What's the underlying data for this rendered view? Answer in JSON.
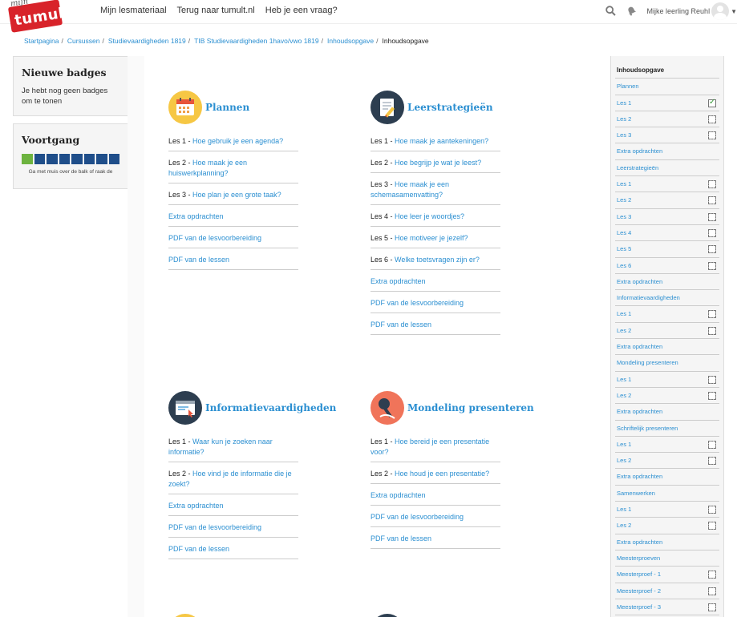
{
  "header": {
    "logo_small": "mijn",
    "logo_text": "tumult",
    "nav": [
      "Mijn lesmateriaal",
      "Terug naar tumult.nl",
      "Heb je een vraag?"
    ],
    "user_name": "Mijke leerling Reuhl"
  },
  "breadcrumb": [
    "Startpagina",
    "Cursussen",
    "Studievaardigheden 1819",
    "TIB Studievaardigheden 1havo/vwo 1819",
    "Inhoudsopgave",
    "Inhoudsopgave"
  ],
  "badges": {
    "title": "Nieuwe badges",
    "text": "Je hebt nog geen badges om te tonen"
  },
  "progress": {
    "title": "Voortgang",
    "note": "Ga met muis over de balk of raak de",
    "segments_total": 8,
    "segments_done": 1
  },
  "sections": [
    {
      "title": "Plannen",
      "icon": "calendar-icon",
      "color": "#f6c744",
      "items": [
        {
          "prefix": "Les 1 - ",
          "text": "Hoe gebruik je een agenda?"
        },
        {
          "prefix": "Les 2 - ",
          "text": "Hoe maak je een huiswerkplanning?"
        },
        {
          "prefix": "Les 3 - ",
          "text": "Hoe plan je een grote taak?"
        },
        {
          "prefix": "",
          "text": "Extra opdrachten"
        },
        {
          "prefix": "",
          "text": "PDF van de lesvoorbereiding"
        },
        {
          "prefix": "",
          "text": "PDF van de lessen"
        }
      ]
    },
    {
      "title": "Leerstrategieën",
      "icon": "notepad-pencil-icon",
      "color": "#2d3e50",
      "items": [
        {
          "prefix": "Les 1 - ",
          "text": "Hoe maak je aantekeningen?"
        },
        {
          "prefix": "Les 2 - ",
          "text": "Hoe begrijp je wat je leest?"
        },
        {
          "prefix": "Les 3 - ",
          "text": "Hoe maak je een schemasamenvatting?"
        },
        {
          "prefix": "Les 4 - ",
          "text": "Hoe leer je woordjes?"
        },
        {
          "prefix": "Les 5 - ",
          "text": "Hoe motiveer je jezelf?"
        },
        {
          "prefix": "Les 6 - ",
          "text": "Welke toetsvragen zijn er?"
        },
        {
          "prefix": "",
          "text": "Extra opdrachten"
        },
        {
          "prefix": "",
          "text": "PDF van de lesvoorbereiding"
        },
        {
          "prefix": "",
          "text": "PDF van de lessen"
        }
      ]
    },
    {
      "title": "Informatievaardigheden",
      "icon": "browser-window-icon",
      "color": "#2d3e50",
      "items": [
        {
          "prefix": "Les 1 - ",
          "text": "Waar kun je zoeken naar informatie?"
        },
        {
          "prefix": "Les 2 - ",
          "text": "Hoe vind je de informatie die je zoekt?"
        },
        {
          "prefix": "",
          "text": "Extra opdrachten"
        },
        {
          "prefix": "",
          "text": "PDF van de lesvoorbereiding"
        },
        {
          "prefix": "",
          "text": "PDF van de lessen"
        }
      ]
    },
    {
      "title": "Mondeling presenteren",
      "icon": "microphone-icon",
      "color": "#f0745a",
      "items": [
        {
          "prefix": "Les 1 - ",
          "text": "Hoe bereid je een presentatie voor?"
        },
        {
          "prefix": "Les 2 - ",
          "text": "Hoe houd je een presentatie?"
        },
        {
          "prefix": "",
          "text": "Extra opdrachten"
        },
        {
          "prefix": "",
          "text": "PDF van de lesvoorbereiding"
        },
        {
          "prefix": "",
          "text": "PDF van de lessen"
        }
      ]
    }
  ],
  "sidebar": {
    "title": "Inhoudsopgave",
    "items": [
      {
        "label": "Plannen",
        "check": "none"
      },
      {
        "label": "Les 1",
        "check": "done"
      },
      {
        "label": "Les 2",
        "check": "empty"
      },
      {
        "label": "Les 3",
        "check": "empty"
      },
      {
        "label": "Extra opdrachten",
        "check": "none"
      },
      {
        "label": "Leerstrategieën",
        "check": "none"
      },
      {
        "label": "Les 1",
        "check": "empty"
      },
      {
        "label": "Les 2",
        "check": "empty"
      },
      {
        "label": "Les 3",
        "check": "empty"
      },
      {
        "label": "Les 4",
        "check": "empty"
      },
      {
        "label": "Les 5",
        "check": "empty"
      },
      {
        "label": "Les 6",
        "check": "empty"
      },
      {
        "label": "Extra opdrachten",
        "check": "none"
      },
      {
        "label": "Informatievaardigheden",
        "check": "none"
      },
      {
        "label": "Les 1",
        "check": "empty"
      },
      {
        "label": "Les 2",
        "check": "empty"
      },
      {
        "label": "Extra opdrachten",
        "check": "none"
      },
      {
        "label": "Mondeling presenteren",
        "check": "none"
      },
      {
        "label": "Les 1",
        "check": "empty"
      },
      {
        "label": "Les 2",
        "check": "empty"
      },
      {
        "label": "Extra opdrachten",
        "check": "none"
      },
      {
        "label": "Schriftelijk presenteren",
        "check": "none"
      },
      {
        "label": "Les 1",
        "check": "empty"
      },
      {
        "label": "Les 2",
        "check": "empty"
      },
      {
        "label": "Extra opdrachten",
        "check": "none"
      },
      {
        "label": "Samenwerken",
        "check": "none"
      },
      {
        "label": "Les 1",
        "check": "empty"
      },
      {
        "label": "Les 2",
        "check": "empty"
      },
      {
        "label": "Extra opdrachten",
        "check": "none"
      },
      {
        "label": "Meesterproeven",
        "check": "none"
      },
      {
        "label": "Meesterproef - 1",
        "check": "empty"
      },
      {
        "label": "Meesterproef - 2",
        "check": "empty"
      },
      {
        "label": "Meesterproef - 3",
        "check": "empty"
      }
    ]
  }
}
